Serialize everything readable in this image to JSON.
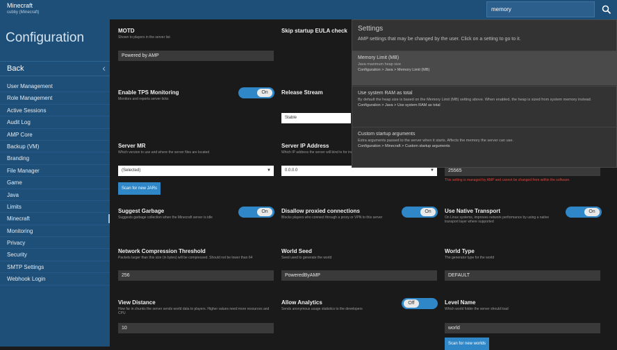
{
  "app": {
    "title": "Minecraft",
    "subtitle": "cubby (Minecraft)"
  },
  "search": {
    "value": "memory",
    "icon": "search-icon"
  },
  "sidebar": {
    "title": "Configuration",
    "back_label": "Back",
    "items": [
      {
        "label": "User Management"
      },
      {
        "label": "Role Management"
      },
      {
        "label": "Active Sessions"
      },
      {
        "label": "Audit Log"
      },
      {
        "label": "AMP Core"
      },
      {
        "label": "Backup (VM)"
      },
      {
        "label": "Branding"
      },
      {
        "label": "File Manager"
      },
      {
        "label": "Game"
      },
      {
        "label": "Java"
      },
      {
        "label": "Limits"
      },
      {
        "label": "Minecraft",
        "active": true
      },
      {
        "label": "Monitoring"
      },
      {
        "label": "Privacy"
      },
      {
        "label": "Security"
      },
      {
        "label": "SMTP Settings"
      },
      {
        "label": "Webhook Login"
      }
    ]
  },
  "settings": {
    "motd": {
      "title": "MOTD",
      "desc": "Shown to players in the server list",
      "value": "Powered by AMP"
    },
    "skip_startup": {
      "title": "Skip startup EULA check"
    },
    "enable_tps": {
      "title": "Enable TPS Monitoring",
      "desc": "Monitors and reports server ticks",
      "toggle": "On"
    },
    "release_stream": {
      "title": "Release Stream",
      "value": "Stable"
    },
    "server_mr": {
      "title": "Server MR",
      "desc": "Which version to use and where the server files are located",
      "value": "(Selected)"
    },
    "server_ip": {
      "title": "Server IP Address",
      "desc": "Which IP address the server will bind to for incoming connections",
      "value": "0.0.0.0"
    },
    "server_port": {
      "value": "25565",
      "warn": "This setting is managed by AMP and cannot be changed from within the software."
    },
    "scan_button": "Scan for new JARs",
    "suggest_gc": {
      "title": "Suggest Garbage",
      "desc": "Suggests garbage collection when the Minecraft server is idle",
      "toggle": "On"
    },
    "disallow_proxied": {
      "title": "Disallow proxied connections",
      "desc": "Blocks players who connect through a proxy or VPN to this server",
      "toggle": "On"
    },
    "use_native": {
      "title": "Use Native Transport",
      "desc": "On Linux systems, improves network performance by using a native transport layer where supported",
      "toggle": "On"
    },
    "net_compress": {
      "title": "Network Compression Threshold",
      "desc": "Packets larger than this size (in bytes) will be compressed. Should not be lower than 64",
      "value": "256"
    },
    "world_seed": {
      "title": "World Seed",
      "desc": "Seed used to generate the world",
      "value": "PoweredByAMP"
    },
    "world_type": {
      "title": "World Type",
      "desc": "The generator type for the world",
      "value": "DEFAULT"
    },
    "view_distance": {
      "title": "View Distance",
      "desc": "How far in chunks the server sends world data to players. Higher values need more resources and CPU",
      "value": "10"
    },
    "allow_analytics": {
      "title": "Allow Analytics",
      "desc": "Sends anonymous usage statistics to the developers",
      "toggle": "Off"
    },
    "level_name": {
      "title": "Level Name",
      "desc": "Which world folder the server should load",
      "value": "world",
      "button": "Scan for new worlds"
    }
  },
  "popover": {
    "title": "Settings",
    "subtitle": "AMP settings that may be changed by the user. Click on a setting to go to it.",
    "results": [
      {
        "title": "Memory Limit (MB)",
        "desc": "Java maximum heap size",
        "path": "Configuration > Java > Memory Limit (MB)",
        "highlight": true
      },
      {
        "title": "Use system RAM as total",
        "desc": "By default the heap size is based on the Memory Limit (MB) setting above. When enabled, the heap is sized from system memory instead.",
        "path": "Configuration > Java > Use system RAM as total"
      },
      {
        "title": "Custom startup arguments",
        "desc": "Extra arguments passed to the server when it starts. Affects the memory the server can use.",
        "path": "Configuration > Minecraft > Custom startup arguments"
      }
    ]
  },
  "colors": {
    "topbar": "#1d4f78",
    "sidebar": "#1d4f78",
    "main_bg": "#1a1a1a",
    "accent": "#2f87c7",
    "warning": "#e0443b"
  }
}
